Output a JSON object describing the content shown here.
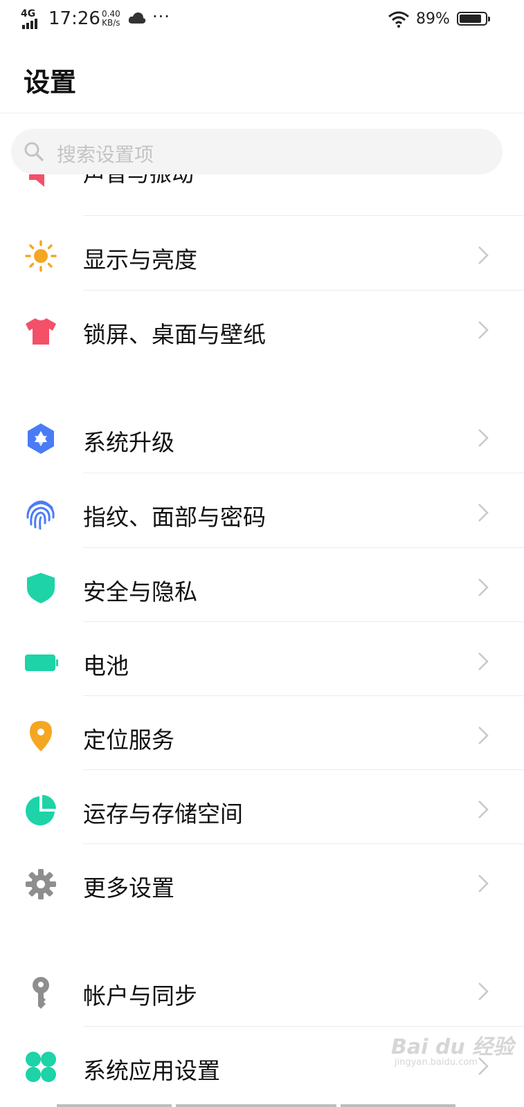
{
  "status_bar": {
    "network": "4G",
    "time": "17:26",
    "speed_value": "0.40",
    "speed_unit": "KB/s",
    "more": "···",
    "battery_percent_text": "89%",
    "battery_level": 0.89
  },
  "header": {
    "title": "设置"
  },
  "search": {
    "placeholder": "搜索设置项"
  },
  "partial_item": {
    "label": "声音与振动"
  },
  "groups": [
    {
      "items": [
        {
          "label": "显示与亮度",
          "icon": "sun-icon",
          "color": "#F5A623"
        },
        {
          "label": "锁屏、桌面与壁纸",
          "icon": "tshirt-icon",
          "color": "#F45068"
        }
      ]
    },
    {
      "items": [
        {
          "label": "系统升级",
          "icon": "system-upgrade-icon",
          "color": "#4A7BF7"
        },
        {
          "label": "指纹、面部与密码",
          "icon": "fingerprint-icon",
          "color": "#4A7BF7"
        },
        {
          "label": "安全与隐私",
          "icon": "shield-icon",
          "color": "#1DD3A7"
        },
        {
          "label": "电池",
          "icon": "battery-icon",
          "color": "#1DD3A7"
        },
        {
          "label": "定位服务",
          "icon": "location-pin-icon",
          "color": "#F5A623"
        },
        {
          "label": "运存与存储空间",
          "icon": "storage-pie-icon",
          "color": "#1DD3A7"
        },
        {
          "label": "更多设置",
          "icon": "gear-icon",
          "color": "#8E8E8E"
        }
      ]
    },
    {
      "items": [
        {
          "label": "帐户与同步",
          "icon": "key-icon",
          "color": "#8E8E8E"
        },
        {
          "label": "系统应用设置",
          "icon": "clover-apps-icon",
          "color": "#1DD3A7"
        }
      ]
    }
  ],
  "watermark": {
    "text": "Bai du 经验",
    "sub": "jingyan.baidu.com"
  }
}
